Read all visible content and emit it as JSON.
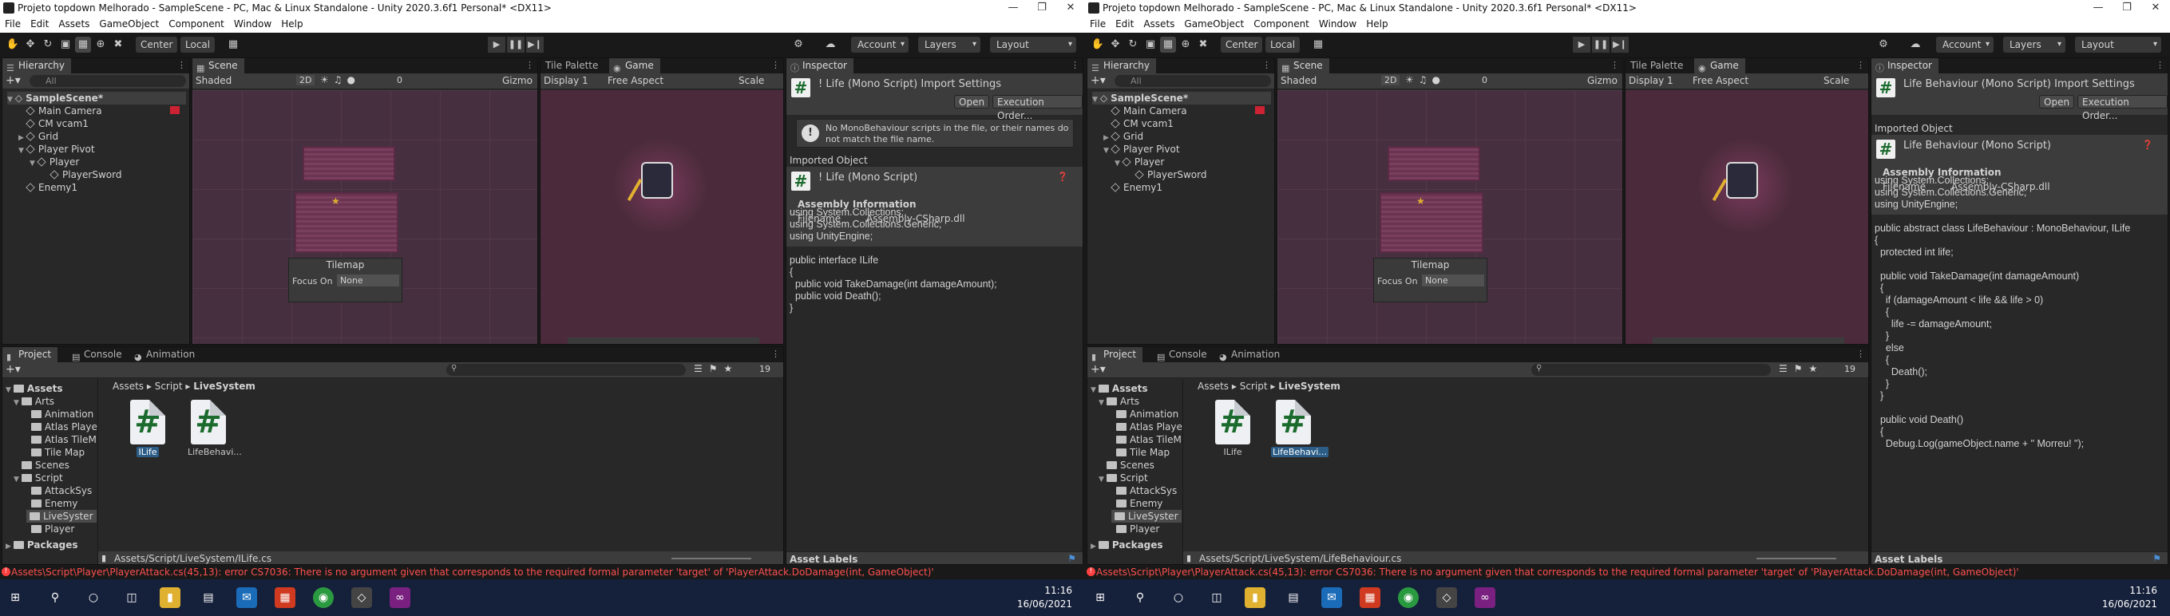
{
  "screens": [
    {
      "window_title": "Projeto topdown Melhorado - SampleScene - PC, Mac & Linux Standalone - Unity 2020.3.6f1 Personal* <DX11>",
      "menu": [
        "File",
        "Edit",
        "Assets",
        "GameObject",
        "Component",
        "Window",
        "Help"
      ],
      "toolbar": {
        "pivot": "Center",
        "space": "Local",
        "account": "Account",
        "layers": "Layers",
        "layout": "Layout"
      },
      "hierarchy": {
        "tab": "Hierarchy",
        "search": "All",
        "scene": "SampleScene*",
        "items": [
          "Main Camera",
          "CM vcam1",
          "Grid",
          "Player Pivot",
          "Player",
          "PlayerSword",
          "Enemy1"
        ]
      },
      "scene_tab": {
        "tab": "Scene",
        "shading": "Shaded",
        "mode_2d": "2D",
        "gizmos": "Gizmo",
        "fx_count": "0"
      },
      "tilemap_overlay": {
        "title": "Tilemap",
        "focus_label": "Focus On",
        "focus_value": "None"
      },
      "game_tab": {
        "tab_palette": "Tile Palette",
        "tab": "Game",
        "display": "Display 1",
        "aspect": "Free Aspect",
        "scale": "Scale"
      },
      "inspector": {
        "tab": "Inspector",
        "header_title": "! Life (Mono Script) Import Settings",
        "open_btn": "Open",
        "exec_order_btn": "Execution Order...",
        "warning": "No MonoBehaviour scripts in the file, or their names do not match the file name.",
        "imported_object": "Imported Object",
        "object_title": "! Life (Mono Script)",
        "assembly_info": "Assembly Information",
        "filename_label": "Filename",
        "filename_value": "Assembly-CSharp.dll",
        "code": "using System.Collections;\nusing System.Collections.Generic;\nusing UnityEngine;\n\npublic interface ILife\n{\n  public void TakeDamage(int damageAmount);\n  public void Death();\n}",
        "asset_labels": "Asset Labels"
      },
      "project": {
        "tab_project": "Project",
        "tab_console": "Console",
        "tab_animation": "Animation",
        "breadcrumb": [
          "Assets",
          "Script",
          "LiveSystem"
        ],
        "hidden_count": "19",
        "tree": [
          "Assets",
          "Arts",
          "Animation",
          "Atlas Playe",
          "Atlas TileM",
          "Tile Map",
          "Scenes",
          "Script",
          "AttackSys",
          "Enemy",
          "LiveSyster",
          "Player",
          "Packages"
        ],
        "assets": [
          {
            "name": "ILife",
            "selected": true
          },
          {
            "name": "LifeBehavi...",
            "selected": false
          }
        ],
        "path": "Assets/Script/LiveSystem/ILife.cs"
      },
      "console_error": "Assets\\Script\\Player\\PlayerAttack.cs(45,13): error CS7036: There is no argument given that corresponds to the required formal parameter 'target' of 'PlayerAttack.DoDamage(int, GameObject)'",
      "clock": {
        "time": "11:16",
        "date": "16/06/2021"
      }
    },
    {
      "window_title": "Projeto topdown Melhorado - SampleScene - PC, Mac & Linux Standalone - Unity 2020.3.6f1 Personal* <DX11>",
      "menu": [
        "File",
        "Edit",
        "Assets",
        "GameObject",
        "Component",
        "Window",
        "Help"
      ],
      "toolbar": {
        "pivot": "Center",
        "space": "Local",
        "account": "Account",
        "layers": "Layers",
        "layout": "Layout"
      },
      "hierarchy": {
        "tab": "Hierarchy",
        "search": "All",
        "scene": "SampleScene*",
        "items": [
          "Main Camera",
          "CM vcam1",
          "Grid",
          "Player Pivot",
          "Player",
          "PlayerSword",
          "Enemy1"
        ]
      },
      "scene_tab": {
        "tab": "Scene",
        "shading": "Shaded",
        "mode_2d": "2D",
        "gizmos": "Gizmo",
        "fx_count": "0"
      },
      "tilemap_overlay": {
        "title": "Tilemap",
        "focus_label": "Focus On",
        "focus_value": "None"
      },
      "game_tab": {
        "tab_palette": "Tile Palette",
        "tab": "Game",
        "display": "Display 1",
        "aspect": "Free Aspect",
        "scale": "Scale"
      },
      "inspector": {
        "tab": "Inspector",
        "header_title": "Life Behaviour (Mono Script) Import Settings",
        "open_btn": "Open",
        "exec_order_btn": "Execution Order...",
        "imported_object": "Imported Object",
        "object_title": "Life Behaviour (Mono Script)",
        "assembly_info": "Assembly Information",
        "filename_label": "Filename",
        "filename_value": "Assembly-CSharp.dll",
        "code": "using System.Collections;\nusing System.Collections.Generic;\nusing UnityEngine;\n\npublic abstract class LifeBehaviour : MonoBehaviour, ILife\n{\n  protected int life;\n\n  public void TakeDamage(int damageAmount)\n  {\n    if (damageAmount < life && life > 0)\n    {\n      life -= damageAmount;\n    }\n    else\n    {\n      Death();\n    }\n  }\n\n  public void Death()\n  {\n    Debug.Log(gameObject.name + \" Morreu! \");",
        "asset_labels": "Asset Labels"
      },
      "project": {
        "tab_project": "Project",
        "tab_console": "Console",
        "tab_animation": "Animation",
        "breadcrumb": [
          "Assets",
          "Script",
          "LiveSystem"
        ],
        "hidden_count": "19",
        "tree": [
          "Assets",
          "Arts",
          "Animation",
          "Atlas Playe",
          "Atlas TileM",
          "Tile Map",
          "Scenes",
          "Script",
          "AttackSys",
          "Enemy",
          "LiveSyster",
          "Player",
          "Packages"
        ],
        "assets": [
          {
            "name": "ILife",
            "selected": false
          },
          {
            "name": "LifeBehavi...",
            "selected": true
          }
        ],
        "path": "Assets/Script/LiveSystem/LifeBehaviour.cs"
      },
      "console_error": "Assets\\Script\\Player\\PlayerAttack.cs(45,13): error CS7036: There is no argument given that corresponds to the required formal parameter 'target' of 'PlayerAttack.DoDamage(int, GameObject)'",
      "clock": {
        "time": "11:16",
        "date": "16/06/2021"
      }
    }
  ],
  "colors": {
    "scene_bg": "#4b2b3b",
    "error": "#ff5050",
    "selection": "#2c5d87",
    "taskbar": "#15203a"
  }
}
